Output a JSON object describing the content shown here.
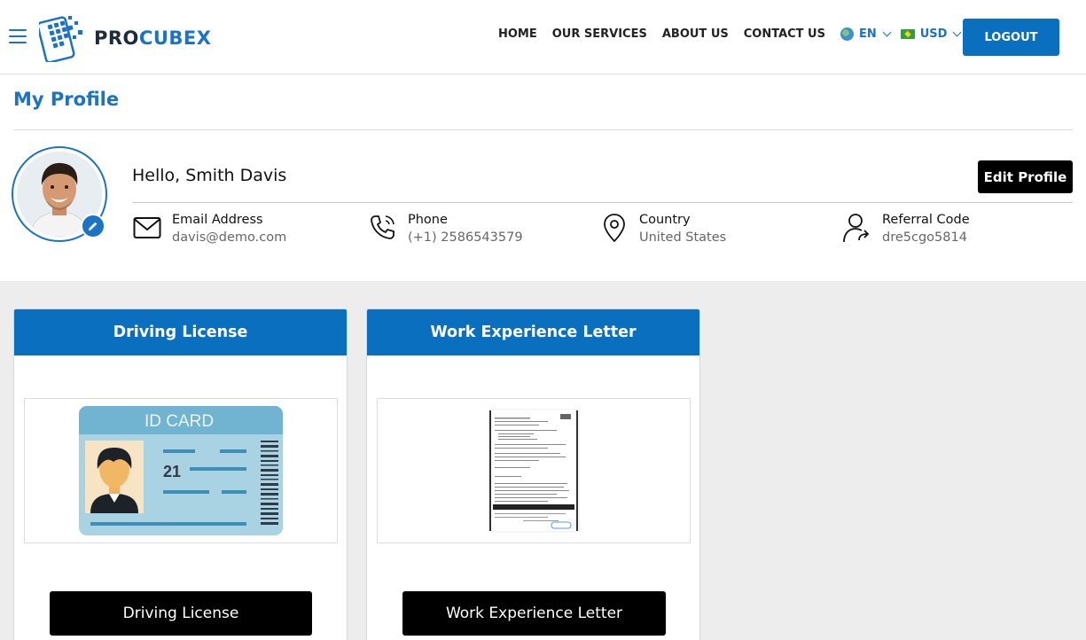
{
  "brand": {
    "pro": "PRO",
    "cubex": "CUBEX"
  },
  "nav": {
    "items": [
      "HOME",
      "OUR SERVICES",
      "ABOUT US",
      "CONTACT US"
    ],
    "language": "EN",
    "currency": "USD",
    "logout_label": "LOGOUT"
  },
  "page": {
    "title": "My Profile"
  },
  "profile": {
    "greeting": "Hello, Smith Davis",
    "edit_label": "Edit Profile",
    "email_label": "Email Address",
    "email": "davis@demo.com",
    "phone_label": "Phone",
    "phone": "(+1) 2586543579",
    "country_label": "Country",
    "country": "United States",
    "referral_label": "Referral Code",
    "referral": "dre5cgo5814"
  },
  "documents": [
    {
      "title": "Driving License",
      "image_text": "ID CARD",
      "image_number": "21",
      "button": "Driving License"
    },
    {
      "title": "Work Experience Letter",
      "button": "Work Experience Letter"
    }
  ],
  "colors": {
    "accent": "#0b6fbf",
    "dark": "#000000",
    "gray_bg": "#ededed"
  }
}
